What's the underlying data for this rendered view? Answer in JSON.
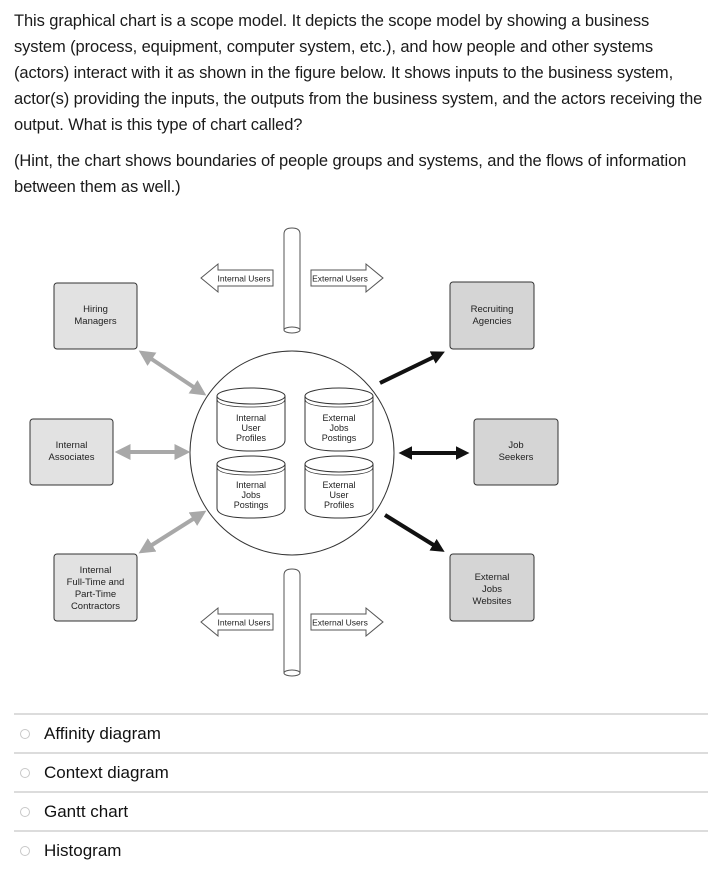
{
  "question": {
    "paragraph": "This graphical chart is a scope model. It depicts the scope model by showing a business system (process, equipment, computer system, etc.), and how people and other systems (actors) interact with it as shown in the figure below. It shows inputs to the business system, actor(s) providing the inputs, the outputs from the business system, and the actors receiving the output. What is this type of chart called?",
    "hint": "(Hint, the chart shows boundaries of people groups and systems, and the flows of information between them as well.)"
  },
  "diagram": {
    "colors": {
      "internal_box_fill": "#e2e2e2",
      "external_box_fill": "#d5d5d5",
      "internal_arrow": "#a8a8a8",
      "external_arrow": "#111111"
    },
    "boundary_top": {
      "left_label": "Internal Users",
      "right_label": "External Users"
    },
    "boundary_bottom": {
      "left_label": "Internal Users",
      "right_label": "External Users"
    },
    "internal_actors": [
      {
        "lines": [
          "Hiring",
          "Managers"
        ]
      },
      {
        "lines": [
          "Internal",
          "Associates"
        ]
      },
      {
        "lines": [
          "Internal",
          "Full-Time and",
          "Part-Time",
          "Contractors"
        ]
      }
    ],
    "external_actors": [
      {
        "lines": [
          "Recruiting",
          "Agencies"
        ],
        "flow": "output"
      },
      {
        "lines": [
          "Job",
          "Seekers"
        ],
        "flow": "bidirectional"
      },
      {
        "lines": [
          "External",
          "Jobs",
          "Websites"
        ],
        "flow": "output"
      }
    ],
    "datastores": [
      {
        "lines": [
          "Internal",
          "User",
          "Profiles"
        ]
      },
      {
        "lines": [
          "External",
          "Jobs",
          "Postings"
        ]
      },
      {
        "lines": [
          "Internal",
          "Jobs",
          "Postings"
        ]
      },
      {
        "lines": [
          "External",
          "User",
          "Profiles"
        ]
      }
    ]
  },
  "options": [
    {
      "label": "Affinity diagram",
      "selected": false
    },
    {
      "label": "Context diagram",
      "selected": false
    },
    {
      "label": "Gantt chart",
      "selected": false
    },
    {
      "label": "Histogram",
      "selected": false
    }
  ]
}
